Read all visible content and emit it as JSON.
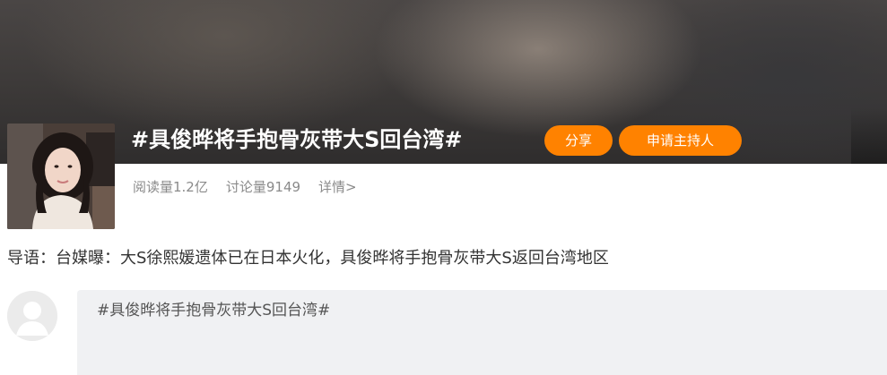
{
  "topic": {
    "title": "#具俊晔将手抱骨灰带大S回台湾#",
    "share_label": "分享",
    "host_label": "申请主持人",
    "reads": "阅读量1.2亿",
    "discussions": "讨论量9149",
    "details_link": "详情>"
  },
  "guide": {
    "text": "导语：台媒曝：大S徐熙媛遗体已在日本火化，具俊晔将手抱骨灰带大S返回台湾地区"
  },
  "compose": {
    "text": "#具俊晔将手抱骨灰带大S回台湾#"
  },
  "colors": {
    "accent_orange": "#ff8200",
    "compose_bg": "#f0f1f3",
    "muted_text": "#8a8a8a"
  },
  "icons": {
    "topic_avatar": "topic-photo",
    "user_avatar": "default-user-avatar"
  }
}
